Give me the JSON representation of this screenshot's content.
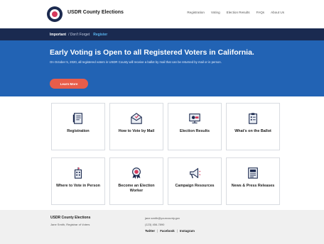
{
  "header": {
    "site_title": "USDR County Elections",
    "nav": [
      "Registration",
      "Voting",
      "Election Results",
      "FAQs",
      "About Us"
    ]
  },
  "strip": {
    "important": "Important",
    "dont_forget": "/ Don't Forget",
    "register": "Register"
  },
  "hero": {
    "title": "Early Voting is Open to all Registered Voters in California.",
    "body": "On October 5, 2020, all registered voters in USDR County will receive a ballot by mail that can be returned by mail or in person.",
    "button": "Learn More"
  },
  "cards": [
    {
      "label": "Registration",
      "icon": "registration-icon"
    },
    {
      "label": "How to Vote by Mail",
      "icon": "mail-icon"
    },
    {
      "label": "Election Results",
      "icon": "results-icon"
    },
    {
      "label": "What's on the Ballot",
      "icon": "ballot-icon"
    },
    {
      "label": "Where to Vote in Person",
      "icon": "building-icon"
    },
    {
      "label": "Become an Election Worker",
      "icon": "badge-icon"
    },
    {
      "label": "Campaign Resources",
      "icon": "megaphone-icon"
    },
    {
      "label": "News & Press Releases",
      "icon": "news-icon"
    }
  ],
  "footer": {
    "title": "USDR County Elections",
    "subtitle": "Jane Smith, Registrar of Voters",
    "email": "jane.smith@yourcounty.gov",
    "phone": "(123) 456-7890",
    "social": [
      "Twitter",
      "Facebook",
      "Instagram"
    ],
    "social_sep": "|"
  },
  "colors": {
    "navy": "#1a2a50",
    "hero_blue": "#2263b4",
    "accent": "#e85d4a",
    "link_blue": "#59b5f0"
  }
}
